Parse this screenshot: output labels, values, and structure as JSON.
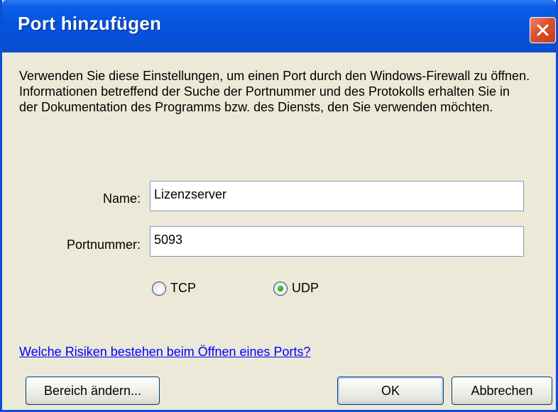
{
  "window": {
    "title": "Port hinzufügen",
    "close_icon": "close-icon"
  },
  "description": "Verwenden Sie diese Einstellungen, um einen Port durch den Windows-Firewall zu öffnen. Informationen betreffend der Suche der Portnummer und des Protokolls erhalten Sie in der Dokumentation des Programms bzw. des Diensts, den Sie verwenden möchten.",
  "form": {
    "name_label": "Name:",
    "name_value": "Lizenzserver",
    "port_label": "Portnummer:",
    "port_value": "5093",
    "protocol_options": [
      {
        "label": "TCP",
        "selected": false
      },
      {
        "label": "UDP",
        "selected": true
      }
    ]
  },
  "link_text": "Welche Risiken bestehen beim Öffnen eines Ports?",
  "buttons": {
    "change_scope": "Bereich ändern...",
    "ok": "OK",
    "cancel": "Abbrechen"
  },
  "colors": {
    "titlebar": "#0553DC",
    "dialog_background": "#ECE9D8",
    "close_button": "#D9532E",
    "link": "#0000FF",
    "radio_selected_dot": "#21A121"
  }
}
